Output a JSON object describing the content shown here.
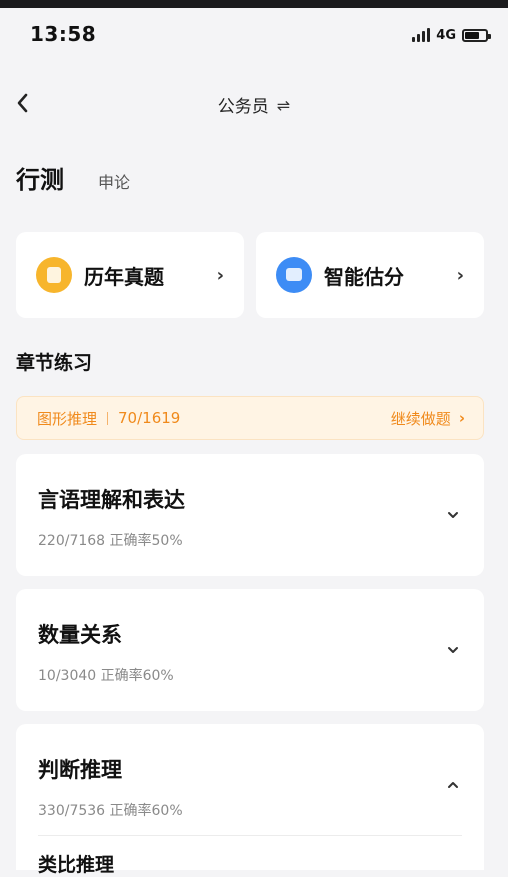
{
  "status": {
    "time": "13:58",
    "network": "4G",
    "battery_level": 0.7
  },
  "nav": {
    "title": "公务员",
    "swap_glyph": "⇌"
  },
  "tabs": [
    {
      "label": "行测",
      "active": true
    },
    {
      "label": "申论",
      "active": false
    }
  ],
  "entries": [
    {
      "label": "历年真题",
      "icon": "exam-paper-icon",
      "color": "#f7b52c"
    },
    {
      "label": "智能估分",
      "icon": "smart-score-icon",
      "color": "#3d8cf5"
    }
  ],
  "section": {
    "title": "章节练习"
  },
  "progress_banner": {
    "topic": "图形推理",
    "progress": "70/1619",
    "action": "继续做题",
    "arrow": "›"
  },
  "chapters": [
    {
      "title": "言语理解和表达",
      "stats": "220/7168 正确率50%",
      "expanded": false
    },
    {
      "title": "数量关系",
      "stats": "10/3040 正确率60%",
      "expanded": false
    },
    {
      "title": "判断推理",
      "stats": "330/7536 正确率60%",
      "expanded": true,
      "sub_items": [
        "类比推理"
      ]
    }
  ],
  "colors": {
    "accent_orange": "#f08a1c",
    "banner_bg": "#fff4e4",
    "page_bg": "#f4f4f6"
  }
}
